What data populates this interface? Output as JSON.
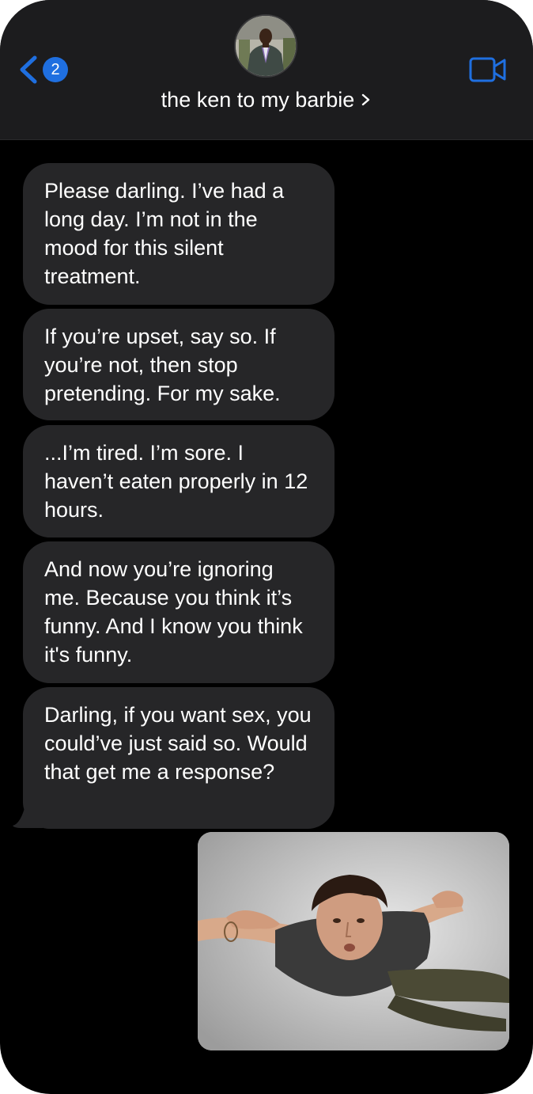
{
  "header": {
    "back_badge_count": "2",
    "contact_name": "the ken to my barbie",
    "icons": {
      "back": "chevron-left-icon",
      "disclosure": "chevron-right-icon",
      "video": "video-camera-icon"
    }
  },
  "messages": [
    {
      "direction": "incoming",
      "text": "Please darling. I’ve had a long day. I’m not in the mood for this silent treatment."
    },
    {
      "direction": "incoming",
      "text": "If you’re upset, say so. If you’re not, then stop pretending. For my sake."
    },
    {
      "direction": "incoming",
      "text": "...I’m tired. I’m sore. I haven’t eaten properly in 12 hours."
    },
    {
      "direction": "incoming",
      "text": "And now you’re ignoring me. Because you think it’s funny. And I know you think it's funny."
    },
    {
      "direction": "incoming",
      "text": "Darling, if you want sex, you could’ve just said so. Would that get me a response?"
    }
  ],
  "photo_message": {
    "direction": "outgoing",
    "kind": "image"
  },
  "colors": {
    "background": "#000000",
    "header": "#1c1c1e",
    "incoming_bubble": "#262628",
    "accent_blue": "#1f6fe0",
    "text": "#ffffff"
  }
}
